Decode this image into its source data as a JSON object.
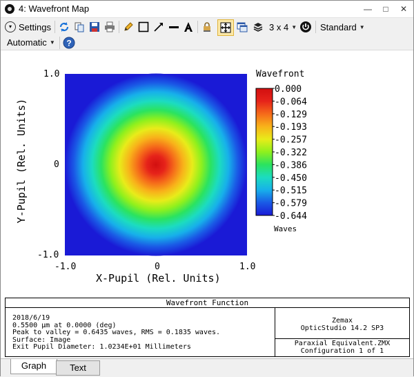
{
  "window": {
    "title": "4: Wavefront Map",
    "controls": [
      "—",
      "□",
      "✕"
    ]
  },
  "toolbar": {
    "settings_label": "Settings",
    "grid_label": "3 x 4",
    "standard_label": "Standard",
    "automatic_label": "Automatic"
  },
  "chart_data": {
    "type": "heatmap",
    "xlabel": "X-Pupil (Rel. Units)",
    "ylabel": "Y-Pupil (Rel. Units)",
    "x_ticks": [
      "-1.0",
      "0",
      "1.0"
    ],
    "y_ticks": [
      "1.0",
      "0",
      "-1.0"
    ],
    "xlim": [
      -1.0,
      1.0
    ],
    "ylim": [
      -1.0,
      1.0
    ],
    "colorbar_title": "Wavefront",
    "colorbar_unit": "Waves",
    "colorbar_ticks": [
      "0.000",
      "-0.064",
      "-0.129",
      "-0.193",
      "-0.257",
      "-0.322",
      "-0.386",
      "-0.450",
      "-0.515",
      "-0.579",
      "-0.644"
    ],
    "vmin": -0.644,
    "vmax": 0.0,
    "background_color": "#1a1ad6",
    "colors": [
      "#1a1ad6",
      "#1a5ae6",
      "#17b0ea",
      "#1cdcc0",
      "#2be35f",
      "#8ff01d",
      "#e8ec1a",
      "#f8b21a",
      "#f56a1a",
      "#e6231a",
      "#d20f10"
    ]
  },
  "info": {
    "title": "Wavefront Function",
    "lines": [
      "2018/6/19",
      "0.5500 µm at 0.0000 (deg)",
      "Peak to valley = 0.6435 waves, RMS = 0.1835 waves.",
      "Surface: Image",
      "Exit Pupil Diameter: 1.0234E+01 Millimeters"
    ],
    "right_top": [
      "Zemax",
      "OpticStudio 14.2 SP3"
    ],
    "right_bottom": [
      "Paraxial Equivalent.ZMX",
      "Configuration 1 of 1"
    ]
  },
  "tabs": [
    {
      "label": "Graph",
      "active": true
    },
    {
      "label": "Text",
      "active": false
    }
  ]
}
